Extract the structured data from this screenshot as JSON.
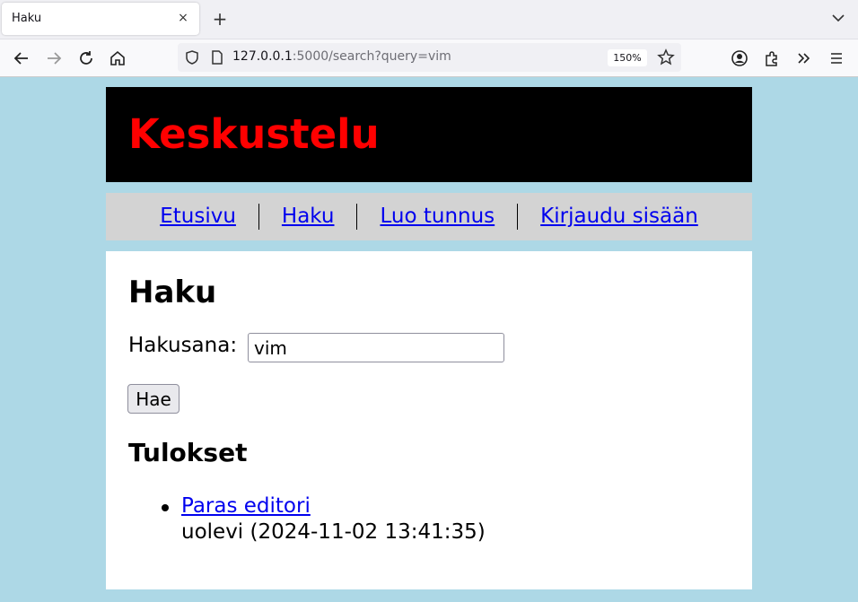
{
  "browser": {
    "tab_title": "Haku",
    "tab_close": "×",
    "new_tab": "+",
    "url_host": "127.0.0.1",
    "url_rest": ":5000/search?query=vim",
    "zoom": "150%"
  },
  "site": {
    "title": "Keskustelu",
    "title_color": "#ff0000",
    "nav": [
      {
        "label": "Etusivu"
      },
      {
        "label": "Haku"
      },
      {
        "label": "Luo tunnus"
      },
      {
        "label": "Kirjaudu sisään"
      }
    ]
  },
  "search": {
    "heading": "Haku",
    "label": "Hakusana:",
    "value": "vim",
    "button": "Hae"
  },
  "results": {
    "heading": "Tulokset",
    "items": [
      {
        "title": "Paras editori",
        "meta": "uolevi (2024-11-02 13:41:35)"
      }
    ]
  },
  "colors": {
    "background": "#add8e6",
    "link": "#0000ee",
    "nav_background": "#d3d3d3"
  }
}
